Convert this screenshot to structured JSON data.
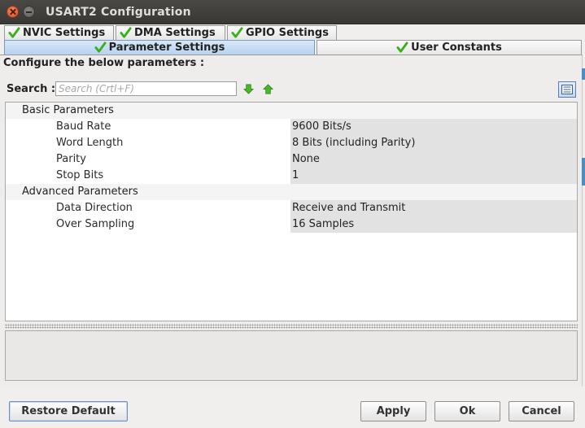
{
  "window": {
    "title": "USART2 Configuration"
  },
  "tabs_row1": [
    {
      "label": "NVIC Settings",
      "icon": "check-icon"
    },
    {
      "label": "DMA Settings",
      "icon": "check-icon"
    },
    {
      "label": "GPIO Settings",
      "icon": "check-icon"
    }
  ],
  "tabs_row2": [
    {
      "label": "Parameter Settings",
      "icon": "check-icon",
      "active": true
    },
    {
      "label": "User Constants",
      "icon": "check-icon",
      "active": false
    }
  ],
  "panel": {
    "configure_label": "Configure the below parameters :",
    "search_label": "Search :",
    "search_placeholder": "Search (Crtl+F)",
    "search_value": ""
  },
  "groups": [
    {
      "name": "Basic Parameters",
      "params": [
        {
          "name": "Baud Rate",
          "value": "9600 Bits/s"
        },
        {
          "name": "Word Length",
          "value": "8 Bits (including Parity)"
        },
        {
          "name": "Parity",
          "value": "None"
        },
        {
          "name": "Stop Bits",
          "value": "1"
        }
      ]
    },
    {
      "name": "Advanced Parameters",
      "params": [
        {
          "name": "Data Direction",
          "value": "Receive and Transmit"
        },
        {
          "name": "Over Sampling",
          "value": "16 Samples"
        }
      ]
    }
  ],
  "buttons": {
    "restore_default": "Restore Default",
    "apply": "Apply",
    "ok": "Ok",
    "cancel": "Cancel"
  },
  "colors": {
    "check": "#3cae1e",
    "accent_blue": "#4a8ec8",
    "value_bg": "#e2e2e2"
  }
}
